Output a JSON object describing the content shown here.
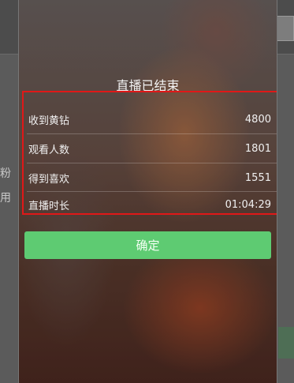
{
  "background": {
    "left_texts": [
      "粉",
      "用"
    ]
  },
  "dialog": {
    "title": "直播已结束",
    "stats": [
      {
        "label": "收到黄钻",
        "value": "4800"
      },
      {
        "label": "观看人数",
        "value": "1801"
      },
      {
        "label": "得到喜欢",
        "value": "1551"
      },
      {
        "label": "直播时长",
        "value": "01:04:29"
      }
    ],
    "confirm_label": "确定",
    "colors": {
      "confirm": "#5ecb72",
      "highlight_box": "#e01818"
    }
  }
}
